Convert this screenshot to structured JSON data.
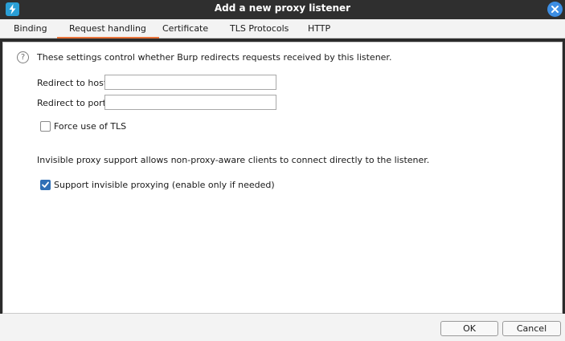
{
  "window": {
    "title": "Add a new proxy listener",
    "app_icon": "burp-lightning-icon",
    "close_icon": "close-icon",
    "accent_color": "#3d8ee3"
  },
  "tabs": [
    {
      "label": "Binding",
      "active": false
    },
    {
      "label": "Request handling",
      "active": true
    },
    {
      "label": "Certificate",
      "active": false
    },
    {
      "label": "TLS Protocols",
      "active": false
    },
    {
      "label": "HTTP",
      "active": false
    }
  ],
  "tab_indicator_color": "#e8733a",
  "request_handling": {
    "description": "These settings control whether Burp redirects requests received by this listener.",
    "redirect_host_label": "Redirect to host:",
    "redirect_host_value": "",
    "redirect_port_label": "Redirect to port:",
    "redirect_port_value": "",
    "force_tls_label": "Force use of TLS",
    "force_tls_checked": false,
    "invisible_description": "Invisible proxy support allows non-proxy-aware clients to connect directly to the listener.",
    "invisible_label": "Support invisible proxying (enable only if needed)",
    "invisible_checked": true
  },
  "footer": {
    "ok_label": "OK",
    "cancel_label": "Cancel"
  }
}
